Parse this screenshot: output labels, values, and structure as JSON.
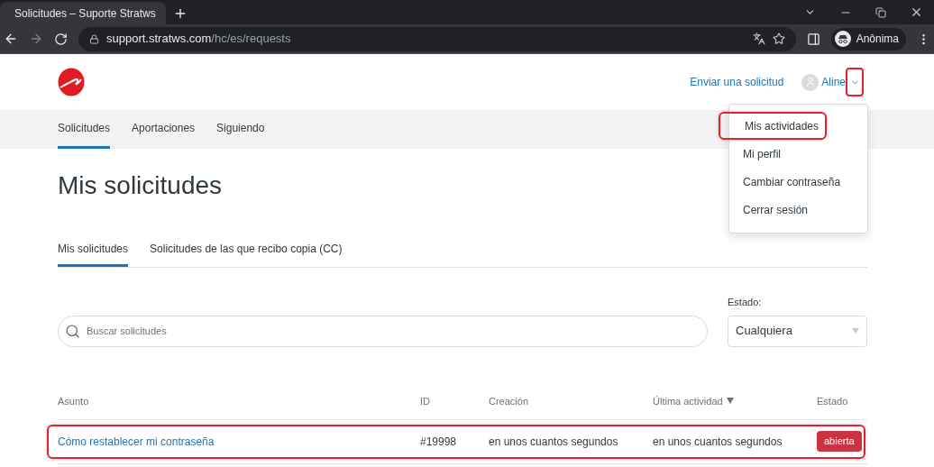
{
  "browser": {
    "tab_title": "Solicitudes – Suporte Stratws",
    "url_host": "support.stratws.com",
    "url_path": "/hc/es/requests",
    "profile": "Anônima"
  },
  "header": {
    "submit_link": "Enviar una solicitud",
    "user_name": "Aline",
    "menu_button_highlighted": true
  },
  "nav_tabs": [
    {
      "label": "Solicitudes",
      "selected": true
    },
    {
      "label": "Aportaciones",
      "selected": false
    },
    {
      "label": "Siguiendo",
      "selected": false
    }
  ],
  "user_menu": {
    "expanded": true,
    "items": [
      {
        "label": "Mis actividades",
        "highlighted": true
      },
      {
        "label": "Mi perfil",
        "highlighted": false
      },
      {
        "label": "Cambiar contraseña",
        "highlighted": false
      },
      {
        "label": "Cerrar sesión",
        "highlighted": false
      }
    ]
  },
  "page_title": "Mis solicitudes",
  "sub_tabs": [
    {
      "label": "Mis solicitudes",
      "selected": true
    },
    {
      "label": "Solicitudes de las que recibo copia (CC)",
      "selected": false
    }
  ],
  "search": {
    "placeholder": "Buscar solicitudes"
  },
  "status_filter": {
    "label": "Estado:",
    "value": "Cualquiera"
  },
  "table": {
    "columns": [
      {
        "label": "Asunto",
        "sorted": false
      },
      {
        "label": "ID",
        "sorted": false
      },
      {
        "label": "Creación",
        "sorted": false
      },
      {
        "label": "Última actividad",
        "sorted": true
      },
      {
        "label": "Estado",
        "sorted": false
      }
    ],
    "rows": [
      {
        "subject": "Cómo restablecer mi contraseña",
        "id": "#19998",
        "created": "en unos cuantos segundos",
        "last_activity": "en unos cuantos segundos",
        "status": "abierta",
        "highlighted": true
      }
    ]
  }
}
